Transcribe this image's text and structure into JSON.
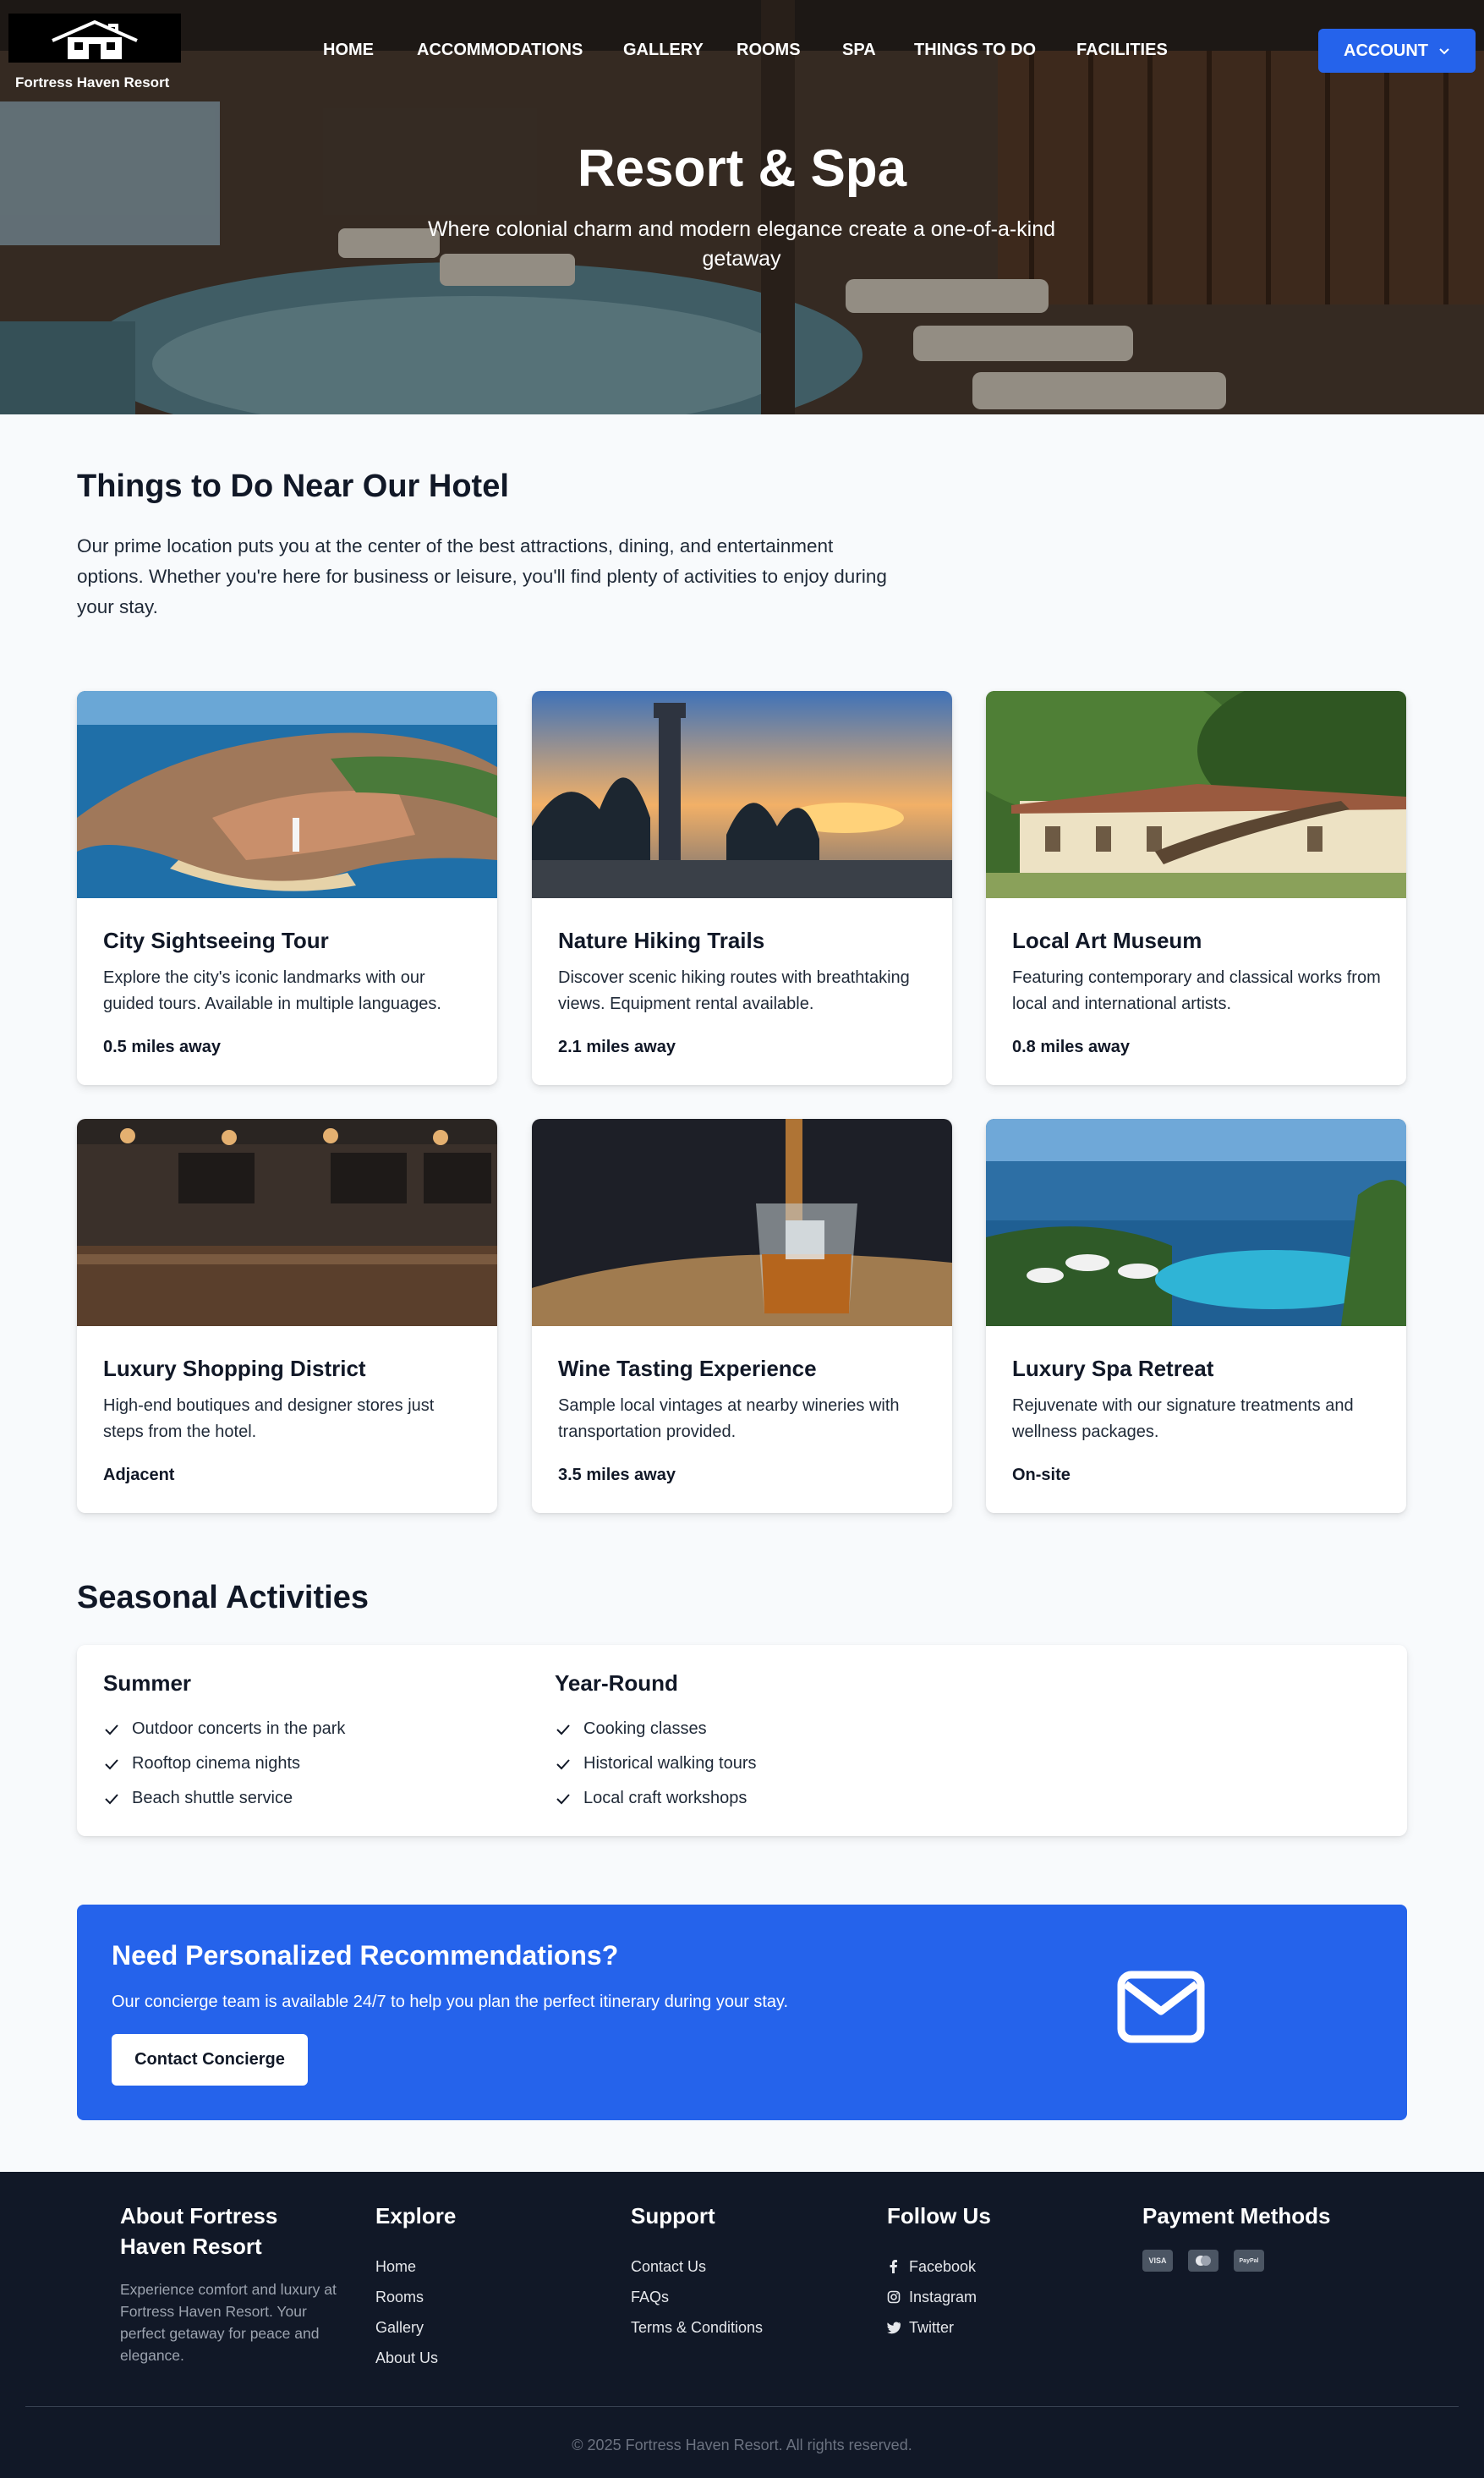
{
  "brand": {
    "name": "Fortress Haven Resort"
  },
  "nav": {
    "links": [
      "HOME",
      "ACCOMMODATIONS",
      "GALLERY",
      "ROOMS",
      "SPA",
      "THINGS TO DO",
      "FACILITIES"
    ],
    "account_label": "ACCOUNT"
  },
  "hero": {
    "title": "Resort & Spa",
    "subtitle": "Where colonial charm and modern elegance create a one-of-a-kind getaway"
  },
  "things": {
    "title": "Things to Do Near Our Hotel",
    "intro": "Our prime location puts you at the center of the best attractions, dining, and entertainment options. Whether you're here for business or leisure, you'll find plenty of activities to enjoy during your stay.",
    "cards": [
      {
        "title": "City Sightseeing Tour",
        "desc": "Explore the city's iconic landmarks with our guided tours. Available in multiple languages.",
        "distance": "0.5 miles away"
      },
      {
        "title": "Nature Hiking Trails",
        "desc": "Discover scenic hiking routes with breathtaking views. Equipment rental available.",
        "distance": "2.1 miles away"
      },
      {
        "title": "Local Art Museum",
        "desc": "Featuring contemporary and classical works from local and international artists.",
        "distance": "0.8 miles away"
      },
      {
        "title": "Luxury Shopping District",
        "desc": "High-end boutiques and designer stores just steps from the hotel.",
        "distance": "Adjacent"
      },
      {
        "title": "Wine Tasting Experience",
        "desc": "Sample local vintages at nearby wineries with transportation provided.",
        "distance": "3.5 miles away"
      },
      {
        "title": "Luxury Spa Retreat",
        "desc": "Rejuvenate with our signature treatments and wellness packages.",
        "distance": "On-site"
      }
    ]
  },
  "seasonal": {
    "title": "Seasonal Activities",
    "summer": {
      "heading": "Summer",
      "items": [
        "Outdoor concerts in the park",
        "Rooftop cinema nights",
        "Beach shuttle service"
      ]
    },
    "year_round": {
      "heading": "Year-Round",
      "items": [
        "Cooking classes",
        "Historical walking tours",
        "Local craft workshops"
      ]
    }
  },
  "cta": {
    "title": "Need Personalized Recommendations?",
    "text": "Our concierge team is available 24/7 to help you plan the perfect itinerary during your stay.",
    "button": "Contact Concierge",
    "icon": "envelope-icon"
  },
  "footer": {
    "about": {
      "heading": "About Fortress Haven Resort",
      "text": "Experience comfort and luxury at Fortress Haven Resort. Your perfect getaway for peace and elegance."
    },
    "explore": {
      "heading": "Explore",
      "links": [
        "Home",
        "Rooms",
        "Gallery",
        "About Us"
      ]
    },
    "support": {
      "heading": "Support",
      "links": [
        "Contact Us",
        "FAQs",
        "Terms & Conditions"
      ]
    },
    "follow": {
      "heading": "Follow Us",
      "links": [
        "Facebook",
        "Instagram",
        "Twitter"
      ]
    },
    "payment": {
      "heading": "Payment Methods",
      "methods": [
        "VISA",
        "Mastercard",
        "PayPal"
      ]
    },
    "copyright": "© 2025 Fortress Haven Resort. All rights reserved."
  },
  "colors": {
    "accent": "#2563eb",
    "footer_bg": "#111827",
    "page_bg": "#f8fafc"
  }
}
